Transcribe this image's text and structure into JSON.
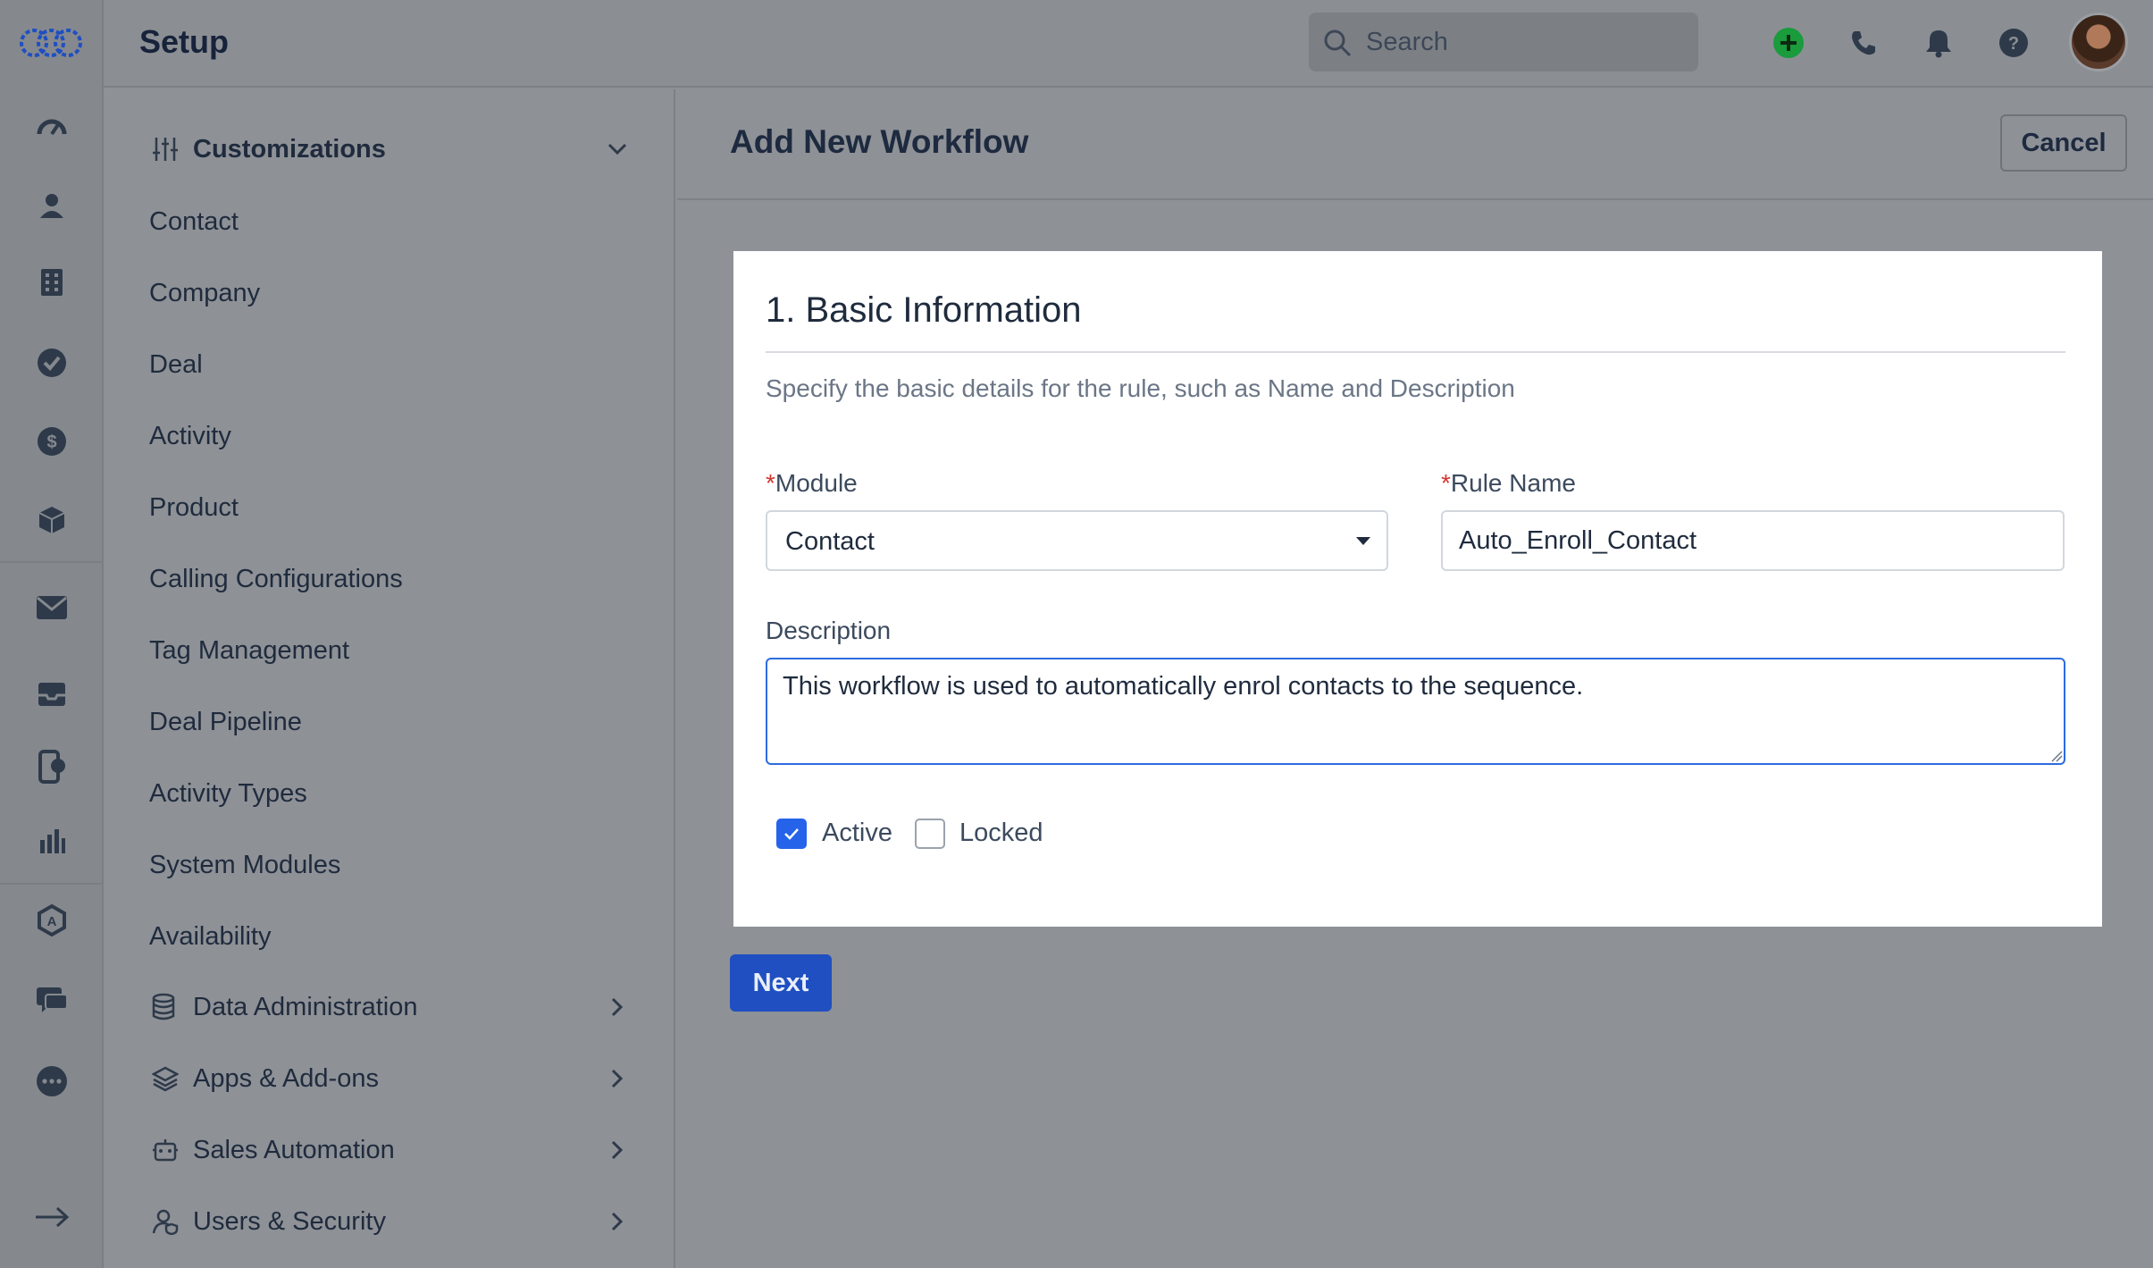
{
  "header": {
    "title": "Setup",
    "search_placeholder": "Search"
  },
  "nav": {
    "customizations_label": "Customizations",
    "items": [
      "Contact",
      "Company",
      "Deal",
      "Activity",
      "Product",
      "Calling Configurations",
      "Tag Management",
      "Deal Pipeline",
      "Activity Types",
      "System Modules",
      "Availability"
    ],
    "groups": [
      "Data Administration",
      "Apps & Add-ons",
      "Sales Automation",
      "Users & Security"
    ]
  },
  "page": {
    "title": "Add New Workflow",
    "cancel_label": "Cancel",
    "next_label": "Next"
  },
  "form": {
    "section_title": "1. Basic Information",
    "section_desc": "Specify the basic details for the rule, such as Name and Description",
    "required_mark": "*",
    "module_label": "Module",
    "module_value": "Contact",
    "rule_name_label": "Rule Name",
    "rule_name_value": "Auto_Enroll_Contact",
    "description_label": "Description",
    "description_value": "This workflow is used to automatically enrol contacts to the sequence.",
    "active_label": "Active",
    "active_checked": true,
    "locked_label": "Locked",
    "locked_checked": false
  },
  "colors": {
    "primary": "#1f4fc1",
    "focus_border": "#2563eb",
    "required": "#d3362f",
    "add_green": "#1a9b3c"
  }
}
